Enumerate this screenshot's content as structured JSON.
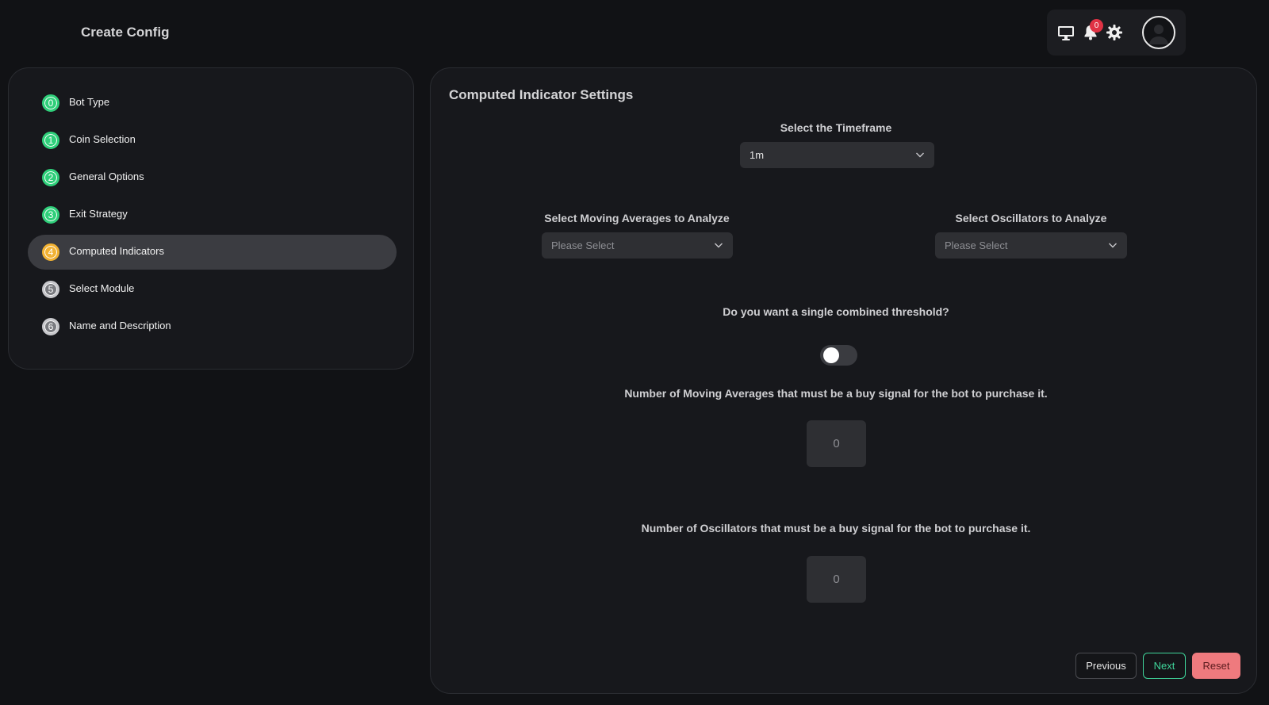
{
  "header": {
    "title": "Create Config",
    "notification_count": "0",
    "icons": [
      "monitor-icon",
      "bell-icon",
      "gear-icon",
      "user-avatar-icon"
    ]
  },
  "steps": [
    {
      "num": "0",
      "label": "Bot Type",
      "status": "done"
    },
    {
      "num": "1",
      "label": "Coin Selection",
      "status": "done"
    },
    {
      "num": "2",
      "label": "General Options",
      "status": "done"
    },
    {
      "num": "3",
      "label": "Exit Strategy",
      "status": "done"
    },
    {
      "num": "4",
      "label": "Computed Indicators",
      "status": "current"
    },
    {
      "num": "5",
      "label": "Select Module",
      "status": "todo"
    },
    {
      "num": "6",
      "label": "Name and Description",
      "status": "todo"
    }
  ],
  "main": {
    "title": "Computed Indicator Settings",
    "timeframe": {
      "label": "Select the Timeframe",
      "value": "1m"
    },
    "moving_averages": {
      "label": "Select Moving Averages to Analyze",
      "placeholder": "Please Select"
    },
    "oscillators": {
      "label": "Select Oscillators to Analyze",
      "placeholder": "Please Select"
    },
    "combined_threshold": {
      "label": "Do you want a single combined threshold?",
      "enabled": false
    },
    "ma_threshold": {
      "label": "Number of Moving Averages that must be a buy signal for the bot to purchase it.",
      "value": "0"
    },
    "osc_threshold": {
      "label": "Number of Oscillators that must be a buy signal for the bot to purchase it.",
      "value": "0"
    }
  },
  "buttons": {
    "previous": "Previous",
    "next": "Next",
    "reset": "Reset"
  },
  "colors": {
    "done": "#2fcf7a",
    "current": "#f2b233",
    "next_accent": "#3fd59a",
    "reset": "#ef7a7e",
    "badge": "#e03244"
  }
}
